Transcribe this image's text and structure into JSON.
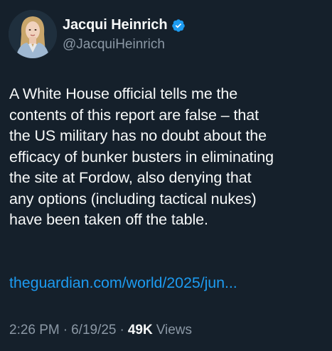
{
  "author": {
    "display_name": "Jacqui Heinrich",
    "handle": "@JacquiHeinrich",
    "verified_icon": "verified-badge-icon",
    "avatar": "profile-photo"
  },
  "tweet": {
    "text": "A White House official tells me the\ncontents of this report are false – that\nthe US military has no doubt about the\nefficacy of bunker busters in eliminating\nthe site at Fordow, also denying that\nany options (including tactical nukes)\nhave been taken off the table.",
    "link_text": "theguardian.com/world/2025/jun..."
  },
  "meta": {
    "time": "2:26 PM",
    "separator": "·",
    "date": "6/19/25",
    "views_count": "49K",
    "views_label": "Views"
  },
  "colors": {
    "background": "#15202b",
    "text": "#f7f9f9",
    "secondary": "#8b98a5",
    "link": "#1d9bf0",
    "verified": "#1d9bf0"
  }
}
